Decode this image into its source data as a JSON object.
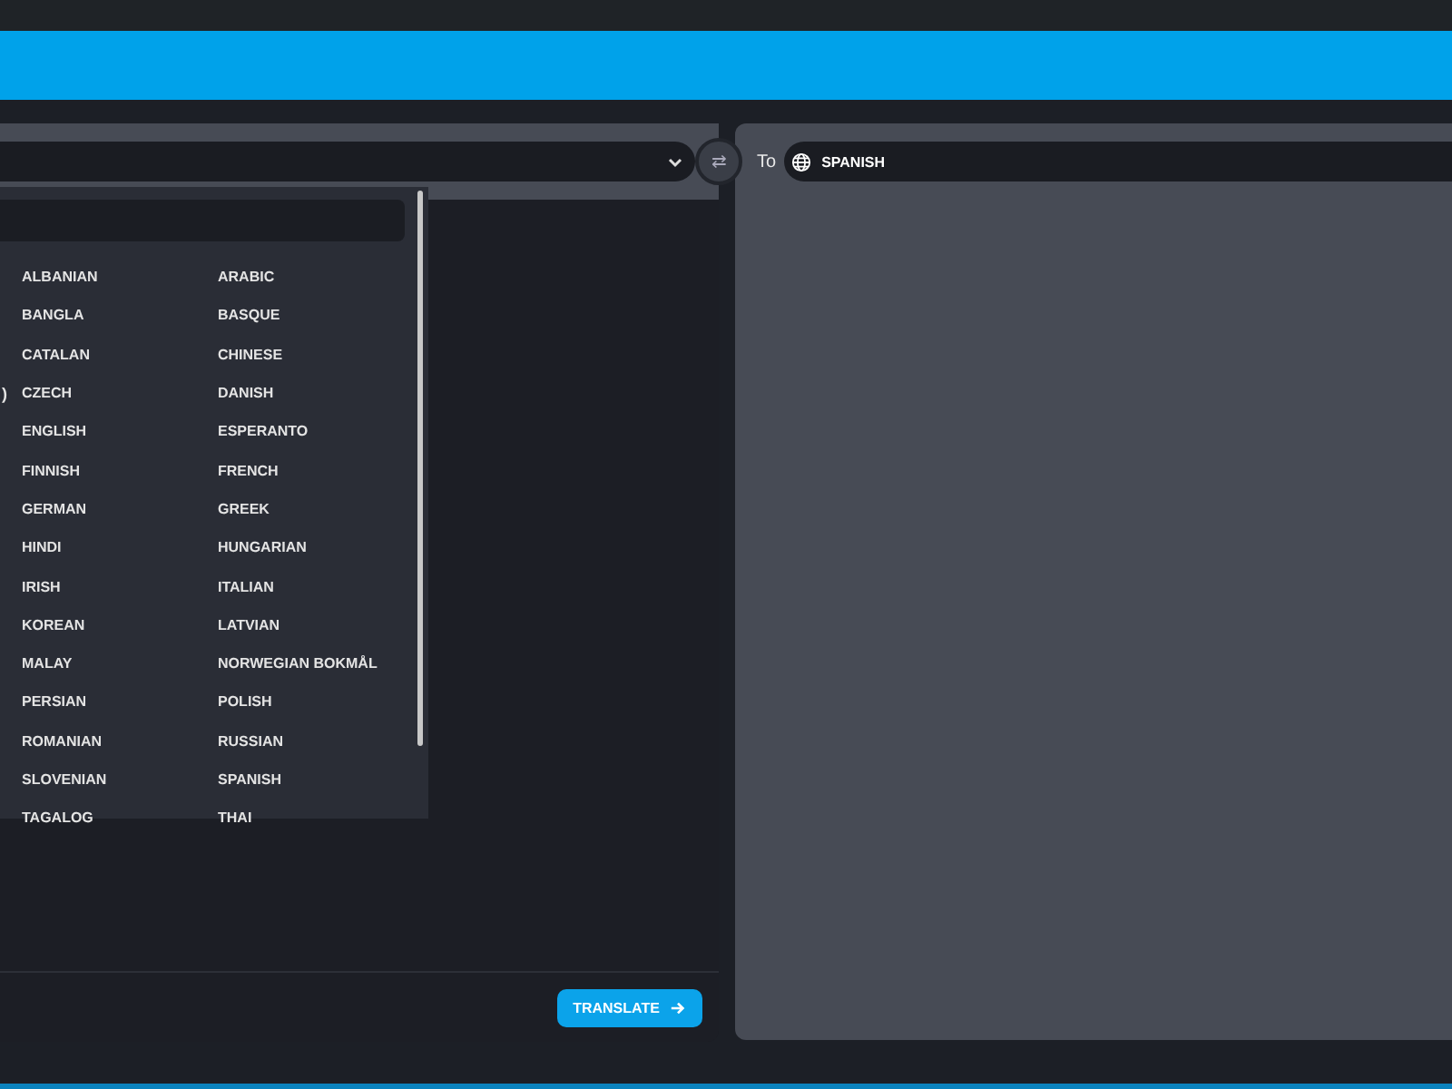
{
  "from_selector": {
    "expanded": true
  },
  "swap_button": {
    "label": "⇄"
  },
  "to_label": "To",
  "to_selector": {
    "value": "SPANISH"
  },
  "language_menu": {
    "rows": [
      {
        "left": "ALBANIAN",
        "right": "ARABIC"
      },
      {
        "left": "BANGLA",
        "right": "BASQUE"
      },
      {
        "left": "CATALAN",
        "right": "CHINESE"
      },
      {
        "fragment": ")",
        "left": "CZECH",
        "right": "DANISH"
      },
      {
        "left": "ENGLISH",
        "right": "ESPERANTO"
      },
      {
        "left": "FINNISH",
        "right": "FRENCH"
      },
      {
        "left": "GERMAN",
        "right": "GREEK"
      },
      {
        "left": "HINDI",
        "right": "HUNGARIAN"
      },
      {
        "left": "IRISH",
        "right": "ITALIAN"
      },
      {
        "left": "KOREAN",
        "right": "LATVIAN"
      },
      {
        "left": "MALAY",
        "right": "NORWEGIAN BOKMÅL"
      },
      {
        "left": "PERSIAN",
        "right": "POLISH"
      },
      {
        "left": "ROMANIAN",
        "right": "RUSSIAN"
      },
      {
        "left": "SLOVENIAN",
        "right": "SPANISH"
      },
      {
        "left": "TAGALOG",
        "right": "THAI"
      }
    ]
  },
  "translate_button": {
    "label": "TRANSLATE"
  }
}
